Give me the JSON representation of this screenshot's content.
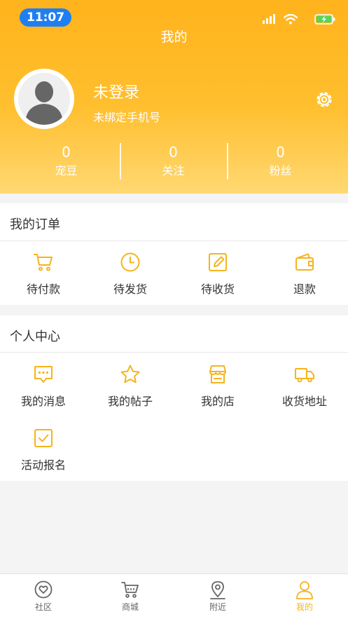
{
  "status_bar": {
    "time": "11:07"
  },
  "header": {
    "title": "我的",
    "user_name": "未登录",
    "user_phone": "未绑定手机号"
  },
  "stats": [
    {
      "value": "0",
      "label": "宠豆"
    },
    {
      "value": "0",
      "label": "关注"
    },
    {
      "value": "0",
      "label": "粉丝"
    }
  ],
  "orders": {
    "title": "我的订单",
    "items": [
      {
        "label": "待付款",
        "icon": "cart-icon"
      },
      {
        "label": "待发货",
        "icon": "clock-icon"
      },
      {
        "label": "待收货",
        "icon": "edit-icon"
      },
      {
        "label": "退款",
        "icon": "wallet-icon"
      }
    ]
  },
  "personal": {
    "title": "个人中心",
    "items": [
      {
        "label": "我的消息",
        "icon": "message-icon"
      },
      {
        "label": "我的帖子",
        "icon": "star-icon"
      },
      {
        "label": "我的店",
        "icon": "store-icon"
      },
      {
        "label": "收货地址",
        "icon": "truck-icon"
      },
      {
        "label": "活动报名",
        "icon": "checkbox-icon"
      }
    ]
  },
  "tabbar": {
    "items": [
      {
        "label": "社区",
        "icon": "community-icon",
        "active": false
      },
      {
        "label": "商城",
        "icon": "shop-cart-icon",
        "active": false
      },
      {
        "label": "附近",
        "icon": "location-icon",
        "active": false
      },
      {
        "label": "我的",
        "icon": "profile-icon",
        "active": true
      }
    ]
  },
  "colors": {
    "accent": "#f5b41c",
    "header_top": "#ffb31c",
    "header_bottom": "#ffd873",
    "time_pill": "#1e7ff2"
  }
}
